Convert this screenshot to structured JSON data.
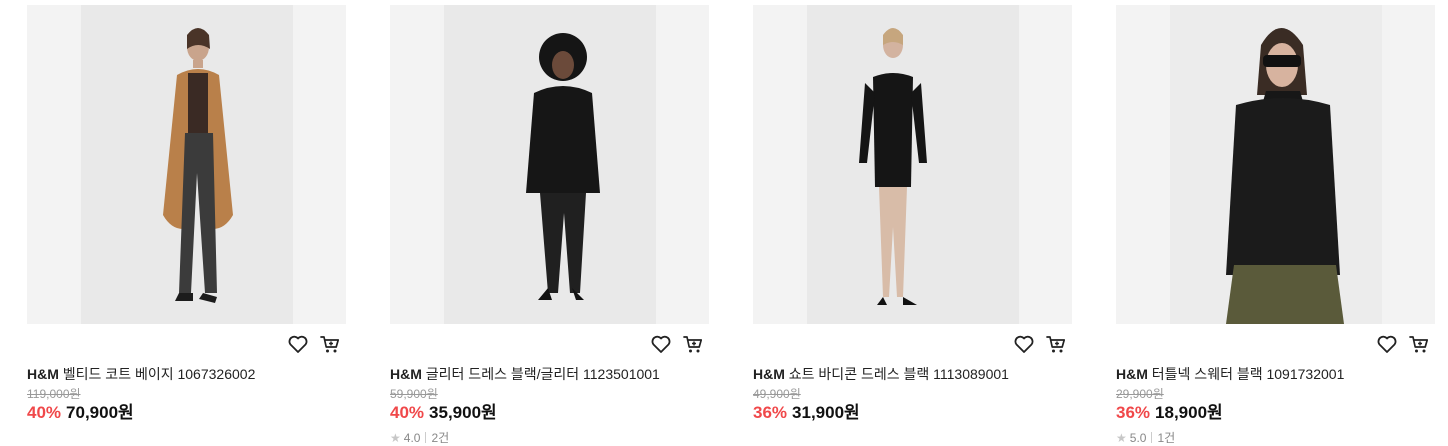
{
  "products": [
    {
      "brand": "H&M",
      "name": "벨티드 코트 베이지 1067326002",
      "original_price": "119,000원",
      "discount": "40%",
      "price": "70,900원",
      "rating": "",
      "review_count": "",
      "image": "model-in-beige-belted-coat"
    },
    {
      "brand": "H&M",
      "name": "글리터 드레스 블랙/글리터 1123501001",
      "original_price": "59,900원",
      "discount": "40%",
      "price": "35,900원",
      "rating": "4.0",
      "review_count": "2건",
      "image": "model-in-black-glitter-dress"
    },
    {
      "brand": "H&M",
      "name": "쇼트 바디콘 드레스 블랙 1113089001",
      "original_price": "49,900원",
      "discount": "36%",
      "price": "31,900원",
      "rating": "",
      "review_count": "",
      "image": "model-in-black-bodycon-dress"
    },
    {
      "brand": "H&M",
      "name": "터틀넥 스웨터 블랙 1091732001",
      "original_price": "29,900원",
      "discount": "36%",
      "price": "18,900원",
      "rating": "5.0",
      "review_count": "1건",
      "image": "model-in-black-turtleneck-sweater"
    }
  ],
  "icons": {
    "wishlist": "heart-icon",
    "cart": "cart-icon",
    "rating": "star-icon"
  },
  "colors": {
    "discount": "#f0484a",
    "price": "#111111",
    "original_price": "#999999"
  }
}
